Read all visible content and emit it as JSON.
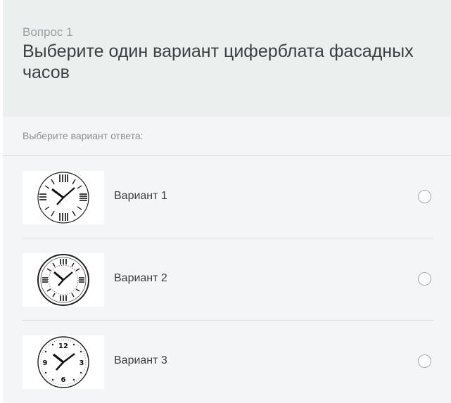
{
  "question": {
    "number_label": "Вопрос 1",
    "text": "Выберите один вариант циферблата фасадных часов"
  },
  "answer_hint": "Выберите вариант ответа:",
  "options": [
    {
      "label": "Вариант 1",
      "icon": "clock-roman-bars-icon"
    },
    {
      "label": "Вариант 2",
      "icon": "clock-roman-dotted-icon"
    },
    {
      "label": "Вариант 3",
      "icon": "clock-arabic-icon"
    }
  ],
  "colors": {
    "header_bg": "#ebefee",
    "body_bg": "#f3f5f7",
    "text": "#3c3f41",
    "muted": "#8a8f92"
  }
}
